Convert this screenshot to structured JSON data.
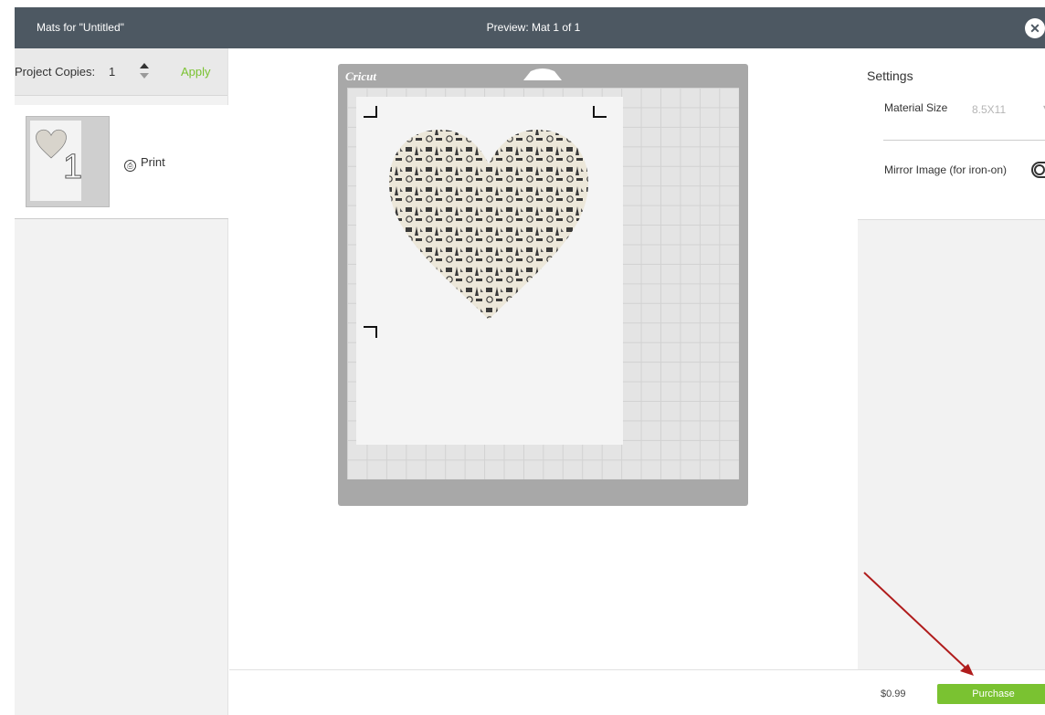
{
  "header": {
    "left_title": "Mats for \"Untitled\"",
    "center_title": "Preview: Mat 1 of 1",
    "close_icon": "close-circle-icon"
  },
  "sidebar": {
    "copies_label": "Project Copies:",
    "copies_value": "1",
    "apply_label": "Apply",
    "mat_number": "1",
    "print_label": "Print"
  },
  "mat": {
    "logo": "Cricut"
  },
  "settings": {
    "title": "Settings",
    "material_size_label": "Material Size",
    "material_size_value": "8.5X11",
    "mirror_label": "Mirror Image (for iron-on)",
    "mirror_on": false
  },
  "footer": {
    "price": "$0.99",
    "purchase_label": "Purchase"
  },
  "colors": {
    "topbar": "#4d5862",
    "accent_green": "#7ac231",
    "annotation_arrow": "#b01c1c"
  }
}
